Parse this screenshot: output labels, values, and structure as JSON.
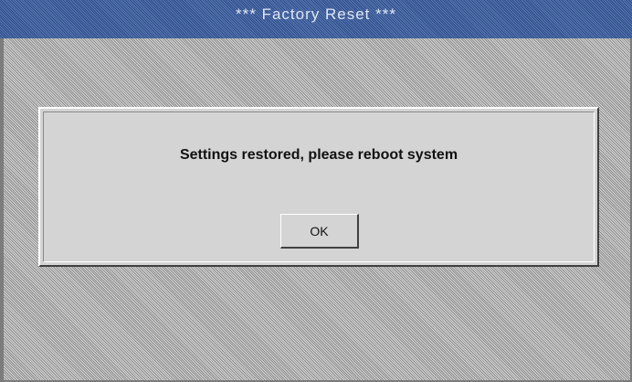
{
  "window": {
    "title": "***  Factory Reset  ***"
  },
  "dialog": {
    "message": "Settings restored, please reboot system",
    "ok_label": "OK"
  }
}
